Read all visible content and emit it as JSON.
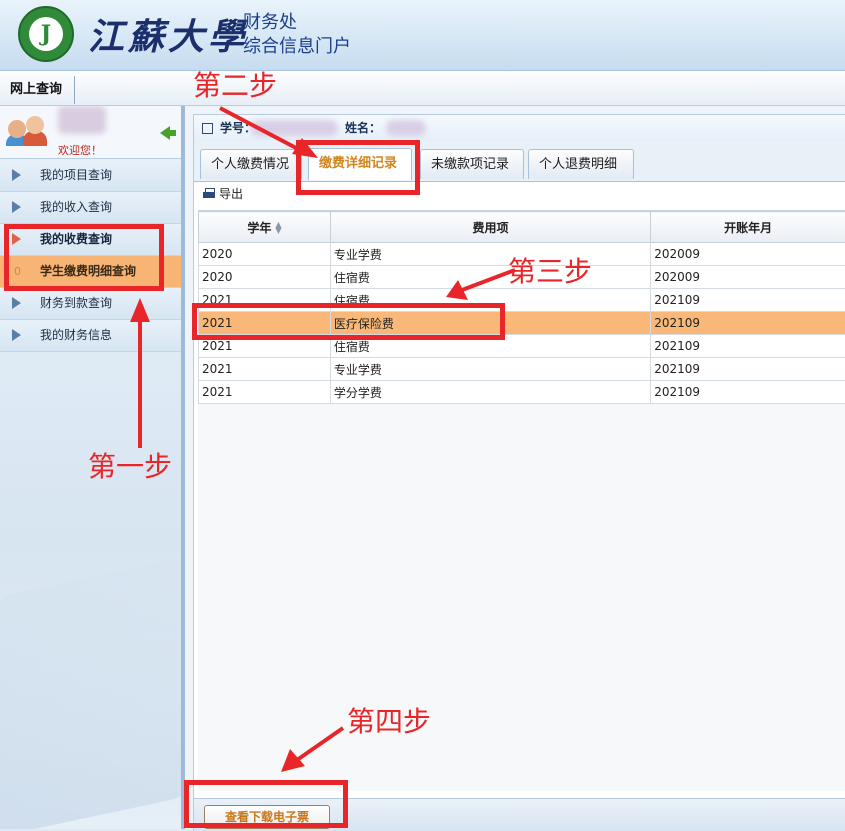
{
  "header": {
    "university_name": "江蘇大學",
    "dept_line1": "财务处",
    "dept_line2": "综合信息门户"
  },
  "navbar": {
    "tab_label": "网上查询"
  },
  "sidebar": {
    "welcome": "欢迎您！",
    "items": [
      {
        "label": "我的项目查询"
      },
      {
        "label": "我的收入查询"
      },
      {
        "label": "我的收费查询"
      },
      {
        "label": "学生缴费明细查询",
        "number": "0"
      },
      {
        "label": "财务到款查询"
      },
      {
        "label": "我的财务信息"
      }
    ]
  },
  "info_bar": {
    "student_id_label": "学号：",
    "name_label": "姓名："
  },
  "tabs": [
    {
      "label": "个人缴费情况"
    },
    {
      "label": "缴费详细记录"
    },
    {
      "label": "未缴款项记录"
    },
    {
      "label": "个人退费明细"
    }
  ],
  "toolbar": {
    "export_label": "导出"
  },
  "table": {
    "columns": [
      "学年",
      "费用项",
      "开账年月"
    ],
    "rows": [
      {
        "year": "2020",
        "item": "专业学费",
        "month": "202009"
      },
      {
        "year": "2020",
        "item": "住宿费",
        "month": "202009"
      },
      {
        "year": "2021",
        "item": "住宿费",
        "month": "202109"
      },
      {
        "year": "2021",
        "item": "医疗保险费",
        "month": "202109"
      },
      {
        "year": "2021",
        "item": "住宿费",
        "month": "202109"
      },
      {
        "year": "2021",
        "item": "专业学费",
        "month": "202109"
      },
      {
        "year": "2021",
        "item": "学分学费",
        "month": "202109"
      }
    ],
    "selected_row": 3
  },
  "bottom": {
    "download_button": "查看下载电子票"
  },
  "annotations": {
    "step1": "第一步",
    "step2": "第二步",
    "step3": "第三步",
    "step4": "第四步",
    "color": "#e8262a"
  },
  "colors": {
    "highlight": "#f9b877",
    "active_tab_text": "#d2861c"
  }
}
